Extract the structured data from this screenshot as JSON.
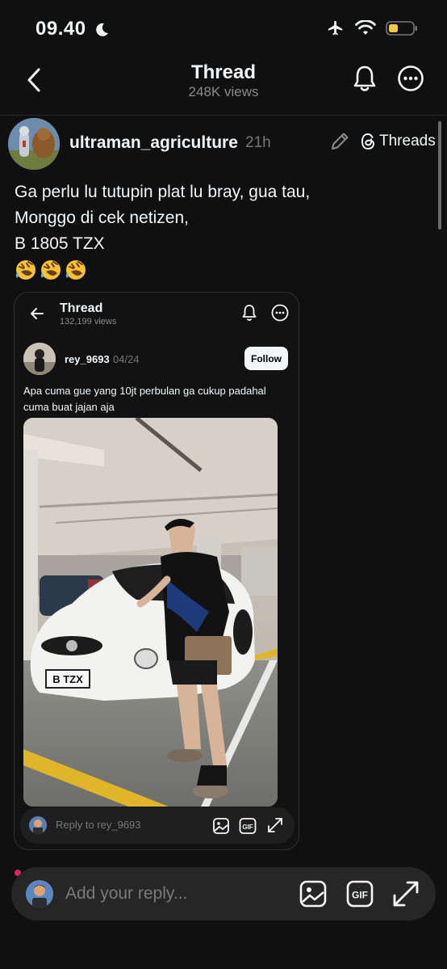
{
  "status_bar": {
    "time": "09.40",
    "icons": [
      "moon-icon",
      "airplane-icon",
      "wifi-icon",
      "battery-icon"
    ],
    "battery_color": "#f2c94c"
  },
  "nav": {
    "title": "Thread",
    "views": "248K views",
    "icons": [
      "back-icon",
      "bell-icon",
      "more-icon"
    ]
  },
  "post": {
    "username": "ultraman_agriculture",
    "time": "21h",
    "badge_label": "Threads",
    "text_lines": [
      "Ga perlu lu tutupin plat lu bray, gua tau,",
      "Monggo di cek netizen,",
      "B 1805 TZX"
    ],
    "emojis": [
      "🤣",
      "🤣",
      "🤣"
    ]
  },
  "embedded": {
    "title": "Thread",
    "views": "132,199 views",
    "username": "rey_9693",
    "date": "04/24",
    "follow_label": "Follow",
    "text": "Apa cuma gue yang 10jt perbulan ga cukup padahal cuma buat jajan aja",
    "plate": "B TZX",
    "reply_placeholder": "Reply to rey_9693"
  },
  "reply_bar": {
    "placeholder": "Add your reply...",
    "icons": [
      "image-icon",
      "gif-icon",
      "expand-icon"
    ]
  }
}
